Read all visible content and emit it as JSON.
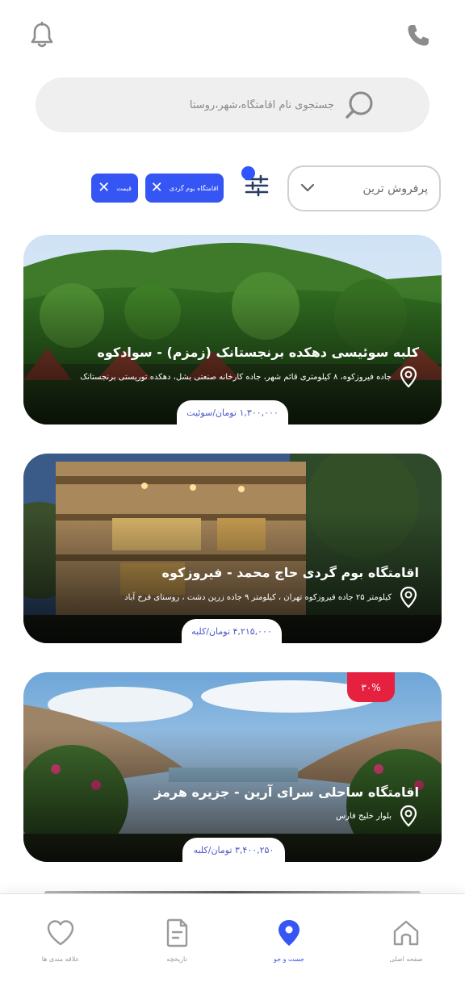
{
  "header": {
    "notifications_icon": "bell-icon",
    "call_icon": "phone-icon"
  },
  "search": {
    "placeholder": "جستجوی نام اقامتگاه،شهر،روستا",
    "icon": "search-icon"
  },
  "sort": {
    "selected": "پرفروش ترین",
    "icon": "chevron-down-icon"
  },
  "filters": {
    "icon": "sliders-icon",
    "active_indicator_color": "#2f55ff",
    "chips": [
      {
        "label": "اقامتگاه بوم گردی"
      },
      {
        "label": "قیمت"
      }
    ]
  },
  "listings": [
    {
      "title": "کلبه سوئیسی دهکده برنجستانک (زمزم) - سوادکوه",
      "address": "جاده فیروزکوه، ۸ کیلومتری قائم شهر، جاده کارخانه صنعتی بشل، دهکده توریستی برنجستانک",
      "price": "۱,۳۰۰,۰۰۰ تومان/سوئیت"
    },
    {
      "title": "اقامتگاه بوم گردی حاج محمد - فیروزکوه",
      "address": "کیلومتر ۲۵ جاده فیروزکوه تهران ، کیلومتر ۹ جاده زرین دشت ، روستای فرح آباد",
      "price": "۴,۲۱۵,۰۰۰ تومان/کلبه"
    },
    {
      "title": "اقامتگاه ساحلی سرای آرین - جزیره هرمز",
      "address": "بلوار خلیج فارس",
      "price": "۳,۴۰۰,۲۵۰ تومان/کلبه",
      "discount": "۳۰%"
    }
  ],
  "colors": {
    "accent": "#3555f4",
    "discount": "#e5213f",
    "price_text": "#4a58c8"
  },
  "nav": {
    "items": [
      {
        "label": "صفحه اصلی",
        "icon": "home-icon"
      },
      {
        "label": "جست و جو",
        "icon": "map-pin-icon",
        "active": true
      },
      {
        "label": "تاریخچه",
        "icon": "document-icon"
      },
      {
        "label": "علاقه مندی ها",
        "icon": "heart-icon"
      }
    ]
  }
}
